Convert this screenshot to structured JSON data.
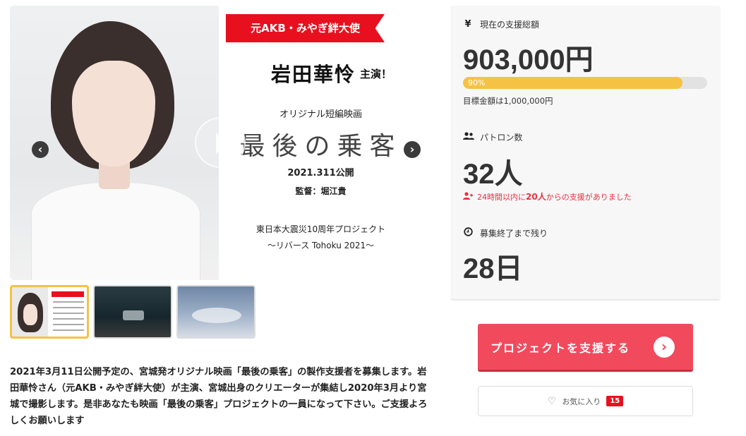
{
  "hero": {
    "poster": {
      "ribbon": "元AKB・みやぎ絆大使",
      "star_name": "岩田華怜",
      "role": "主演！",
      "subtitle": "オリジナル短編映画",
      "film_title": "最後の乗客",
      "release": "2021.311公開",
      "director": "監督：堀江貴",
      "project": "東日本大震災10周年プロジェクト",
      "subproject": "〜リバース Tohoku 2021〜"
    },
    "prev_glyph": "‹",
    "next_glyph": "›",
    "icons": [
      "play-icon",
      "chevron-left-icon",
      "chevron-right-icon"
    ]
  },
  "thumbnails": {
    "count": 3,
    "active_index": 0
  },
  "description": "2021年3月11日公開予定の、宮城発オリジナル映画「最後の乗客」の製作支援者を募集します。岩田華怜さん（元AKB・みやぎ絆大使）が主演、宮城出身のクリエーターが集結し2020年3月より宮城で撮影します。是非あなたも映画「最後の乗客」プロジェクトの一員になって下さい。ご支援よろしくお願いします",
  "stats": {
    "total": {
      "icon": "yen-icon",
      "icon_glyph": "¥",
      "label": "現在の支援総額",
      "value": "903,000円",
      "progress_percent": 90,
      "progress_label": "90%",
      "goal_text": "目標金額は1,000,000円"
    },
    "patrons": {
      "icon": "users-icon",
      "label": "パトロン数",
      "value": "32人",
      "recent_prefix": "24時間以内に",
      "recent_count": "20人",
      "recent_suffix": "からの支援がありました"
    },
    "remaining": {
      "icon": "clock-icon",
      "label": "募集終了まで残り",
      "value": "28日"
    }
  },
  "actions": {
    "support_label": "プロジェクトを支援する",
    "support_arrow": "›",
    "favorite_label": "お気に入り",
    "favorite_count": "15"
  },
  "colors": {
    "ribbon_red": "#e8101f",
    "progress_yellow": "#f5c243",
    "support_pink": "#f24a5d",
    "alert_red": "#e8303f"
  }
}
